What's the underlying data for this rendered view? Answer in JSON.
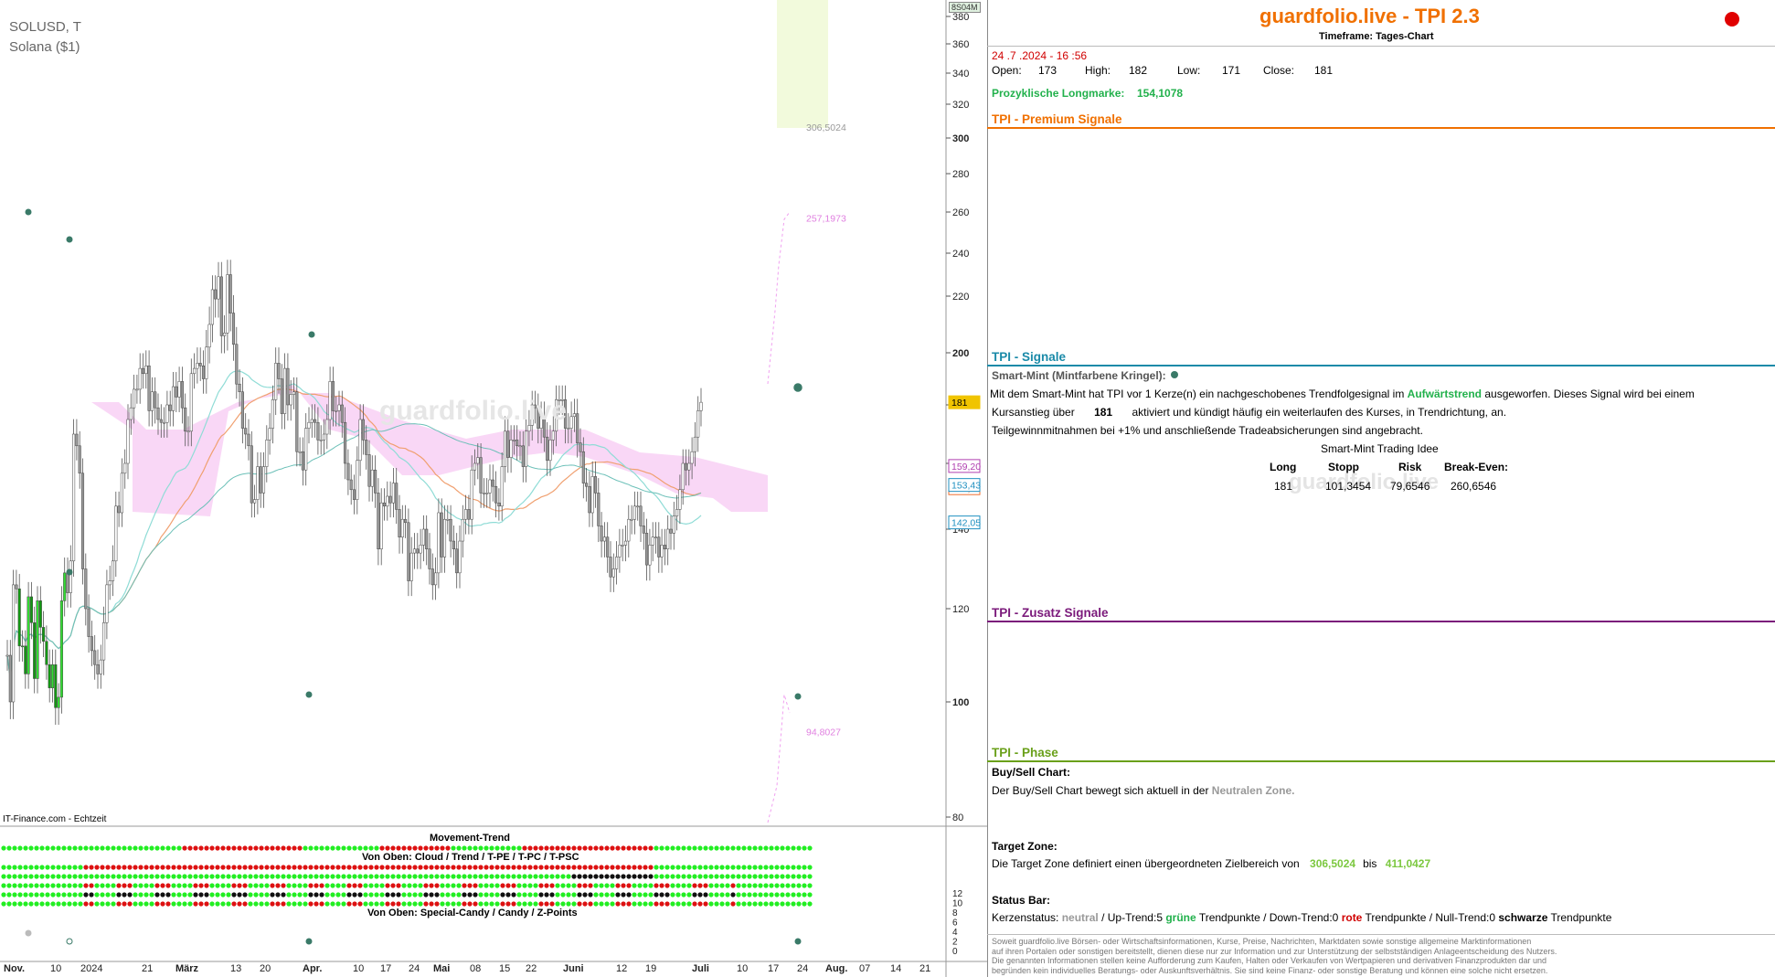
{
  "chart_data": {
    "type": "candlestick",
    "symbol": "SOLUSD, T",
    "name": "Solana ($1)",
    "badge": "8S04M",
    "watermark": "guardfolio.live",
    "source": "IT-Finance.com - Echtzeit",
    "ylim": [
      78,
      385
    ],
    "yticks": [
      80,
      100,
      120,
      140,
      160,
      180,
      200,
      220,
      240,
      260,
      280,
      300,
      320,
      340,
      360,
      380
    ],
    "x_labels": [
      "Nov.",
      "10",
      "2024",
      "21",
      "März",
      "13",
      "20",
      "Apr.",
      "10",
      "17",
      "24",
      "Mai",
      "08",
      "15",
      "22",
      "Juni",
      "12",
      "19",
      "Juli",
      "10",
      "17",
      "24",
      "Aug.",
      "07",
      "14",
      "21"
    ],
    "price_tags": [
      {
        "label": "181",
        "value": 181,
        "color": "#f0c400"
      },
      {
        "label": "159,20",
        "value": 159.2,
        "color": "#b040b0"
      },
      {
        "label": "154,11",
        "value": 154.11,
        "color": "#f07030"
      },
      {
        "label": "153,43",
        "value": 153.43,
        "color": "#2090c0"
      },
      {
        "label": "142,05",
        "value": 142.05,
        "color": "#2090c0"
      }
    ],
    "targets": [
      {
        "label": "306,5024",
        "value": 306.5024,
        "color": "#999999"
      },
      {
        "label": "257,1973",
        "value": 257.1973,
        "color": "#e080e0"
      },
      {
        "label": "94,8027",
        "value": 94.8027,
        "color": "#e080e0"
      }
    ],
    "closes": [
      110,
      100,
      126,
      125,
      112,
      112,
      106,
      123,
      117,
      105,
      122,
      116,
      113,
      108,
      103,
      108,
      99,
      101,
      122,
      129,
      124,
      132,
      170,
      166,
      157,
      130,
      120,
      114,
      111,
      108,
      106,
      109,
      117,
      126,
      127,
      132,
      147,
      145,
      157,
      160,
      175,
      179,
      186,
      186,
      194,
      192,
      195,
      178,
      185,
      179,
      175,
      174,
      174,
      180,
      178,
      187,
      183,
      189,
      179,
      171,
      171,
      192,
      194,
      196,
      195,
      190,
      202,
      210,
      223,
      219,
      229,
      206,
      207,
      230,
      214,
      203,
      188,
      185,
      172,
      170,
      166,
      148,
      149,
      159,
      151,
      159,
      168,
      172,
      182,
      196,
      190,
      177,
      194,
      180,
      184,
      185,
      164,
      164,
      158,
      172,
      174,
      175,
      174,
      168,
      168,
      170,
      175,
      189,
      178,
      178,
      180,
      174,
      160,
      155,
      152,
      149,
      161,
      175,
      168,
      163,
      153,
      158,
      151,
      135,
      148,
      147,
      150,
      148,
      154,
      146,
      138,
      143,
      142,
      127,
      134,
      135,
      134,
      136,
      140,
      135,
      130,
      126,
      129,
      145,
      133,
      143,
      143,
      137,
      135,
      129,
      137,
      143,
      146,
      143,
      158,
      160,
      162,
      151,
      151,
      151,
      155,
      153,
      148,
      147,
      159,
      171,
      162,
      168,
      168,
      166,
      166,
      159,
      171,
      173,
      180,
      179,
      172,
      176,
      169,
      161,
      168,
      171,
      182,
      182,
      182,
      172,
      172,
      176,
      177,
      167,
      164,
      154,
      153,
      145,
      156,
      151,
      141,
      137,
      138,
      133,
      128,
      130,
      133,
      136,
      136,
      137,
      143,
      143,
      147,
      147,
      141,
      139,
      131,
      136,
      138,
      138,
      133,
      136,
      135,
      140,
      139,
      144,
      146,
      152,
      160,
      158,
      160,
      164,
      169,
      178,
      181
    ],
    "movement_trend": {
      "title": "Movement-Trend",
      "subtitle": "Von Oben: Cloud / Trend / T-PE / T-PC / T-PSC",
      "footer": "Von Oben: Special-Candy / Candy / Z-Points",
      "yticks": [
        0,
        2,
        4,
        6,
        8,
        10,
        12
      ]
    }
  },
  "panel": {
    "title": "guardfolio.live - TPI 2.3",
    "timeframe": "Timeframe: Tages-Chart",
    "datetime": "24 .7 .2024  - 16 :56",
    "ohlc": {
      "open_label": "Open:",
      "open": "173",
      "high_label": "High:",
      "high": "182",
      "low_label": "Low:",
      "low": "171",
      "close_label": "Close:",
      "close": "181"
    },
    "long_label": "Prozyklische Longmarke:",
    "long_value": "154,1078",
    "sections": {
      "premium": "TPI - Premium Signale",
      "signale": "TPI - Signale",
      "zusatz": "TPI - Zusatz Signale",
      "phase": "TPI - Phase"
    },
    "smart_mint": {
      "header": "Smart-Mint (Mintfarbene Kringel):",
      "line1_a": "Mit dem Smart-Mint hat TPI vor 1  Kerze(n) ein nachgeschobenes Trendfolgesignal im",
      "line1_b": "Aufwärtstrend",
      "line1_c": "ausgeworfen. Dieses Signal wird bei einem",
      "line2_a": "Kursanstieg über",
      "line2_b": "181",
      "line2_c": "aktiviert und kündigt häufig ein weiterlaufen des Kurses, in Trendrichtung, an.",
      "line3": "Teilgewinnmitnahmen bei +1% und anschließende Tradeabsicherungen sind angebracht.",
      "idea_title": "Smart-Mint Trading Idee",
      "cols": [
        "Long",
        "Stopp",
        "Risk",
        "Break-Even:"
      ],
      "vals": [
        "181",
        "101,3454",
        "79,6546",
        "260,6546"
      ],
      "watermark": "guardfolio.live"
    },
    "phase": {
      "buysell_header": "Buy/Sell Chart:",
      "buysell_a": "Der Buy/Sell Chart bewegt sich aktuell in der",
      "buysell_b": "Neutralen Zone.",
      "target_header": "Target Zone:",
      "target_a": "Die Target Zone definiert einen übergeordneten Zielbereich von",
      "target_low": "306,5024",
      "target_mid": "bis",
      "target_high": "411,0427",
      "status_header": "Status Bar:",
      "status_a": "Kerzenstatus:",
      "status_neutral": "neutral",
      "status_b": "/ Up-Trend:5",
      "status_green": "grüne",
      "status_c": "Trendpunkte  / Down-Trend:0",
      "status_red": "rote",
      "status_d": "Trendpunkte / Null-Trend:0",
      "status_black": "schwarze",
      "status_e": "Trendpunkte"
    },
    "disclaimer": [
      "Soweit guardfolio.live Börsen- oder Wirtschaftsinformationen, Kurse, Preise, Nachrichten, Marktdaten sowie sonstige allgemeine Marktinformationen",
      "auf ihren Portalen oder sonstigen bereitstellt, dienen diese nur zur Information und zur Unterstützung der selbstständigen Anlageentscheidung des Nutzers.",
      "Die genannten Informationen stellen keine Aufforderung zum Kaufen, Halten oder Verkaufen von Wertpapieren und derivativen Finanzprodukten dar und",
      "begründen kein individuelles Beratungs- oder Auskunftsverhältnis. Sie sind keine Finanz- oder sonstige Beratung und können eine solche nicht ersetzen."
    ],
    "colors": {
      "orange": "#f07000",
      "teal": "#1a8aa8",
      "purple": "#7b1a7b",
      "olive": "#6aa01a",
      "green": "#22b14c",
      "red": "#e00000"
    }
  }
}
